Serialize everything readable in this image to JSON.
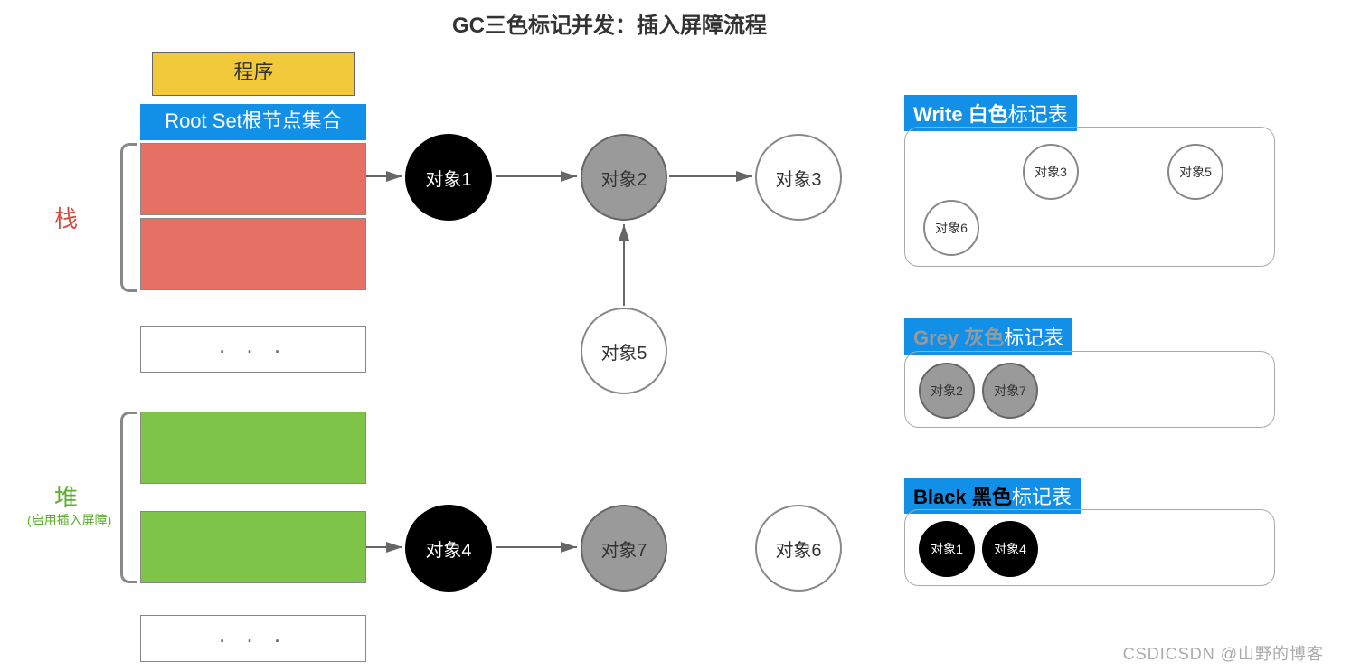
{
  "title": "GC三色标记并发：插入屏障流程",
  "program_label": "程序",
  "rootset_label": "Root Set根节点集合",
  "ellipsis": ". . .",
  "stack_label": "栈",
  "heap_label": "堆",
  "heap_sub": "(启用插入屏障)",
  "nodes": {
    "obj1": "对象1",
    "obj2": "对象2",
    "obj3": "对象3",
    "obj4": "对象4",
    "obj5": "对象5",
    "obj6": "对象6",
    "obj7": "对象7"
  },
  "panels": {
    "white": {
      "prefix": "Write",
      "color": "白色",
      "suffix": "标记表",
      "items": [
        "对象3",
        "对象5",
        "对象6"
      ]
    },
    "grey": {
      "prefix": "Grey",
      "color": "灰色",
      "suffix": "标记表",
      "items": [
        "对象2",
        "对象7"
      ]
    },
    "black": {
      "prefix": "Black",
      "color": "黑色",
      "suffix": "标记表",
      "items": [
        "对象1",
        "对象4"
      ]
    }
  },
  "watermark": "CSDICSDN @山野的博客",
  "colors": {
    "yellow": "#f2c93a",
    "blue": "#1290e8",
    "red": "#e77064",
    "green": "#7dc448",
    "grey": "#9a9a9a",
    "black": "#000000"
  }
}
